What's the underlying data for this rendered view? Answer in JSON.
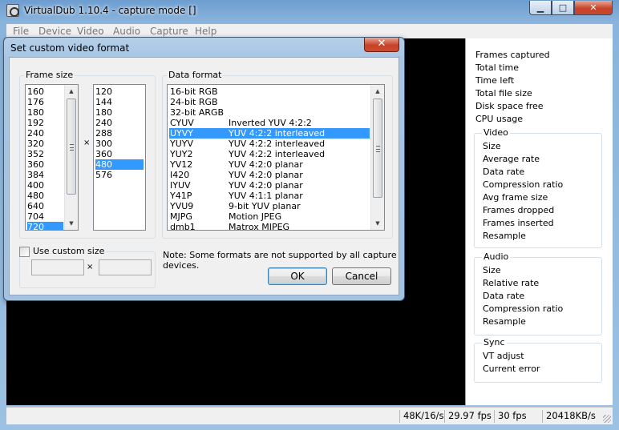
{
  "main_window": {
    "title": "VirtualDub 1.10.4 - capture mode []",
    "caption_buttons": {
      "minimize": "▁",
      "maximize": "□",
      "close": "✕"
    }
  },
  "menu": [
    "File",
    "Device",
    "Video",
    "Audio",
    "Capture",
    "Help"
  ],
  "stats": {
    "top": [
      "Frames captured",
      "Total time",
      "Time left",
      "Total file size",
      "Disk space free",
      "CPU usage"
    ],
    "video": {
      "label": "Video",
      "items": [
        "Size",
        "Average rate",
        "Data rate",
        "Compression ratio",
        "Avg frame size",
        "Frames dropped",
        "Frames inserted",
        "Resample"
      ]
    },
    "audio": {
      "label": "Audio",
      "items": [
        "Size",
        "Relative rate",
        "Data rate",
        "Compression ratio",
        "Resample"
      ]
    },
    "sync": {
      "label": "Sync",
      "items": [
        "VT adjust",
        "Current error"
      ]
    }
  },
  "status_bar": [
    "48K/16/s",
    "29.97 fps",
    "30 fps",
    "20418KB/s"
  ],
  "dialog": {
    "title": "Set custom video format",
    "close_glyph": "✕",
    "frame_size": {
      "label": "Frame size",
      "times": "×",
      "widths": [
        "160",
        "176",
        "180",
        "192",
        "240",
        "320",
        "352",
        "360",
        "384",
        "400",
        "480",
        "640",
        "704",
        "720"
      ],
      "width_selected": "720",
      "heights": [
        "120",
        "144",
        "180",
        "240",
        "288",
        "300",
        "360",
        "480",
        "576"
      ],
      "height_selected": "480"
    },
    "custom_size": {
      "label": "Use custom size",
      "checked": false,
      "width_value": "",
      "height_value": "",
      "times": "×"
    },
    "data_format": {
      "label": "Data format",
      "selected": "UYVY",
      "items": [
        {
          "code": "16-bit RGB",
          "desc": ""
        },
        {
          "code": "24-bit RGB",
          "desc": ""
        },
        {
          "code": "32-bit ARGB",
          "desc": ""
        },
        {
          "code": "CYUV",
          "desc": "Inverted YUV 4:2:2"
        },
        {
          "code": "UYVY",
          "desc": "YUV 4:2:2 interleaved"
        },
        {
          "code": "YUYV",
          "desc": "YUV 4:2:2 interleaved"
        },
        {
          "code": "YUY2",
          "desc": "YUV 4:2:2 interleaved"
        },
        {
          "code": "YV12",
          "desc": "YUV 4:2:0 planar"
        },
        {
          "code": "I420",
          "desc": "YUV 4:2:0 planar"
        },
        {
          "code": "IYUV",
          "desc": "YUV 4:2:0 planar"
        },
        {
          "code": "Y41P",
          "desc": "YUV 4:1:1 planar"
        },
        {
          "code": "YVU9",
          "desc": "9-bit YUV planar"
        },
        {
          "code": "MJPG",
          "desc": "Motion JPEG"
        },
        {
          "code": "dmb1",
          "desc": "Matrox MJPEG"
        }
      ]
    },
    "note": "Note: Some formats are not supported by all capture devices.",
    "ok_label": "OK",
    "cancel_label": "Cancel"
  },
  "scroll_glyphs": {
    "up": "▲",
    "down": "▼"
  }
}
